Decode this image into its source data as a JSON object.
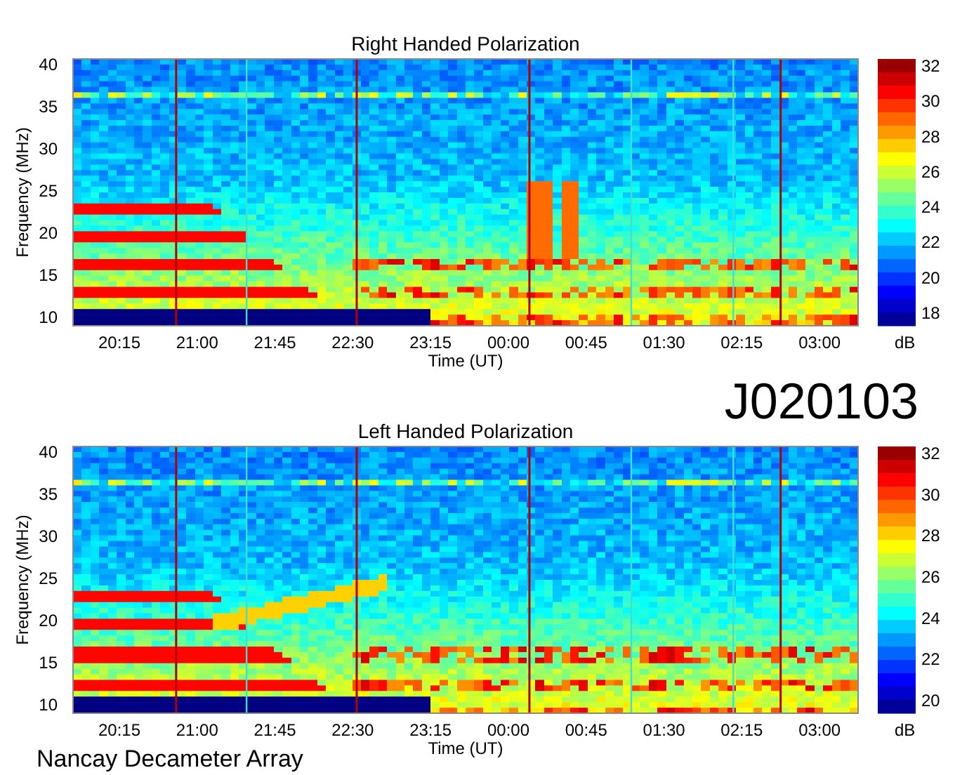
{
  "panels": [
    {
      "title": "Right Handed Polarization",
      "ylabel": "Frequency (MHz)",
      "xlabel": "Time (UT)",
      "yticks": [
        "40",
        "35",
        "30",
        "25",
        "20",
        "15",
        "10"
      ],
      "xticks": [
        "20:15",
        "21:00",
        "21:45",
        "22:30",
        "23:15",
        "00:00",
        "00:45",
        "01:30",
        "02:15",
        "03:00"
      ],
      "colorbar_ticks": [
        "32",
        "30",
        "28",
        "26",
        "24",
        "22",
        "20",
        "18"
      ],
      "colorbar_unit": "dB"
    },
    {
      "title": "Left Handed Polarization",
      "ylabel": "Frequency (MHz)",
      "xlabel": "Time (UT)",
      "yticks": [
        "40",
        "35",
        "30",
        "25",
        "20",
        "15",
        "10"
      ],
      "xticks": [
        "20:15",
        "21:00",
        "21:45",
        "22:30",
        "23:15",
        "00:00",
        "00:45",
        "01:30",
        "02:15",
        "03:00"
      ],
      "colorbar_ticks": [
        "32",
        "30",
        "28",
        "26",
        "24",
        "22",
        "20"
      ],
      "colorbar_unit": "dB"
    }
  ],
  "observation_id": "J020103",
  "footer": "Nancay Decameter Array"
}
